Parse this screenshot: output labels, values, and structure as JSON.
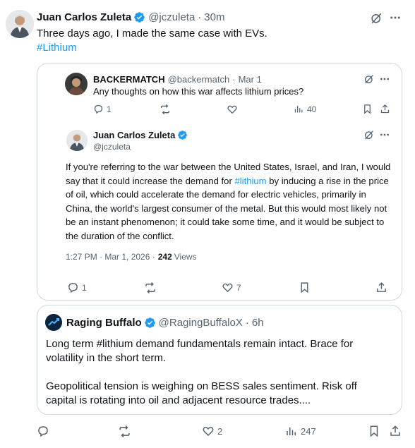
{
  "main_post": {
    "author_name": "Juan Carlos Zuleta",
    "handle": "@jczuleta",
    "separator": "·",
    "time": "30m",
    "text_line1": "Three days ago, I made the same case with EVs.",
    "hashtag": "#Lithium",
    "actions": {
      "reply_count": "",
      "repost_count": "",
      "like_count": "2",
      "views_count": "247"
    }
  },
  "quoted_thread": {
    "parent": {
      "author_name": "BACKERMATCH",
      "handle": "@backermatch",
      "separator": "·",
      "date": "Mar 1",
      "text": "Any thoughts on how this war affects lithium prices?",
      "reply_count": "1",
      "views_count": "40"
    },
    "reply": {
      "author_name": "Juan Carlos Zuleta",
      "handle": "@jczuleta",
      "text_before_link": "If you're referring to the war between the United States, Israel, and Iran, I would say that it could increase the demand for ",
      "link_text": "#lithium",
      "text_after_link": " by inducing a rise in the price of oil, which could accelerate the demand for electric vehicles, primarily in China, the world's largest consumer of the metal. But this would most likely not be an instant phenomenon; it could take some time, and it would be subject to the duration of the conflict.",
      "timestamp": "1:27 PM · Mar 1, 2026 ·",
      "views_number": "242",
      "views_label": "Views",
      "reply_count": "1",
      "like_count": "7"
    }
  },
  "quote_card": {
    "author_name": "Raging Buffalo",
    "handle": "@RagingBuffaloX",
    "separator": "·",
    "time": "6h",
    "paragraph1": "Long term #lithium demand fundamentals remain intact. Brace for volatility in the short term.",
    "paragraph2": "Geopolitical tension is weighing on BESS sales sentiment. Risk off capital is rotating into oil and adjacent resource trades...."
  },
  "colors": {
    "text": "#0f1419",
    "muted": "#536471",
    "link": "#1d9bf0",
    "border": "#cfd9de",
    "verified": "#1d9bf0"
  },
  "icons": [
    "grok-icon",
    "more-icon",
    "reply-icon",
    "repost-icon",
    "like-icon",
    "views-icon",
    "bookmark-icon",
    "share-icon",
    "verified-badge-icon"
  ]
}
